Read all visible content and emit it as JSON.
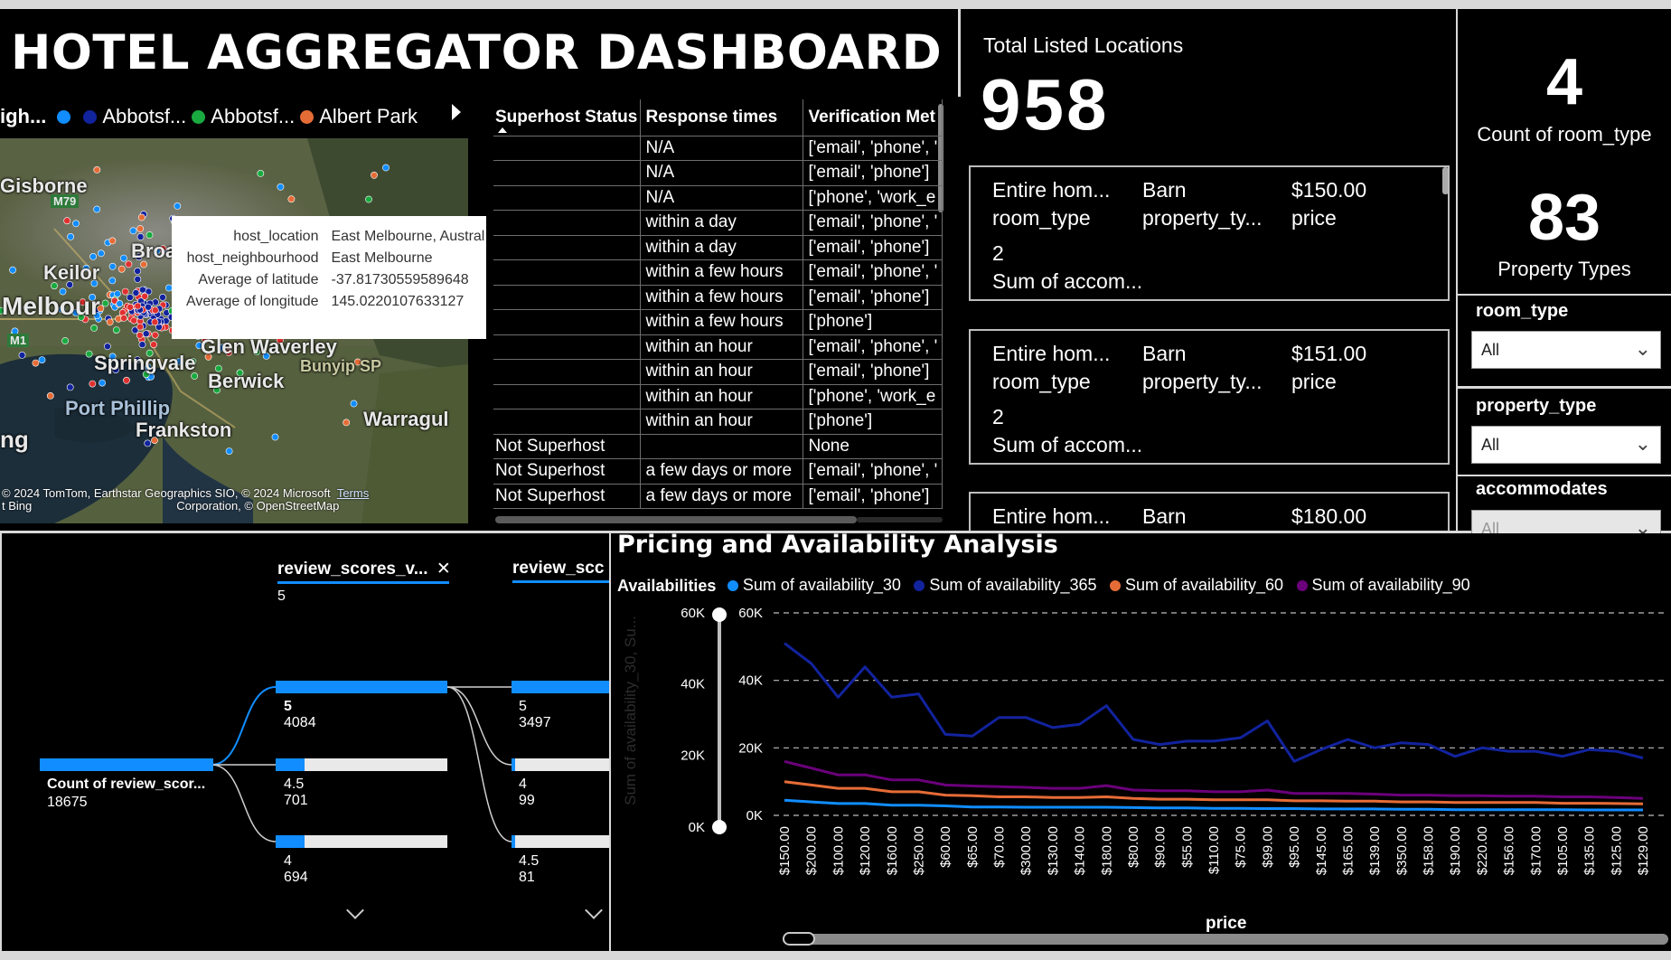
{
  "header": {
    "title": "HOTEL AGGREGATOR DASHBOARD"
  },
  "map": {
    "legend": {
      "truncated_label": "igh...",
      "items": [
        {
          "label": "",
          "color": "#118dff"
        },
        {
          "label": "Abbotsf...",
          "color": "#12239e"
        },
        {
          "label": "Abbotsf...",
          "color": "#1aab40"
        },
        {
          "label": "Albert Park",
          "color": "#e66c37"
        }
      ]
    },
    "place_labels": [
      "Gisborne",
      "Keilor",
      "Broa",
      "Melbour",
      "Glen Waverley",
      "Springvale",
      "Bunyip SP",
      "Berwick",
      "Port Phillip",
      "Warragul",
      "Frankston",
      "ng",
      "M79",
      "M1"
    ],
    "tooltip": {
      "rows": [
        {
          "key": "host_location",
          "value": "East Melbourne, Austral"
        },
        {
          "key": "host_neighbourhood",
          "value": "East Melbourne"
        },
        {
          "key": "Average of latitude",
          "value": "-37.81730559589648"
        },
        {
          "key": "Average of longitude",
          "value": "145.0220107633127"
        }
      ]
    },
    "attribution": "© 2024 TomTom, Earthstar Geographics SIO, © 2024 Microsoft",
    "attribution2": "Corporation, © OpenStreetMap",
    "attribution_terms": "Terms",
    "attribution_bing": "t Bing"
  },
  "host_table": {
    "columns": [
      "Superhost Status",
      "Response times",
      "Verification Met"
    ],
    "rows": [
      [
        "",
        "N/A",
        "['email', 'phone', '"
      ],
      [
        "",
        "N/A",
        "['email', 'phone']"
      ],
      [
        "",
        "N/A",
        "['phone', 'work_e"
      ],
      [
        "",
        "within a day",
        "['email', 'phone', '"
      ],
      [
        "",
        "within a day",
        "['email', 'phone']"
      ],
      [
        "",
        "within a few hours",
        "['email', 'phone', '"
      ],
      [
        "",
        "within a few hours",
        "['email', 'phone']"
      ],
      [
        "",
        "within a few hours",
        "['phone']"
      ],
      [
        "",
        "within an hour",
        "['email', 'phone', '"
      ],
      [
        "",
        "within an hour",
        "['email', 'phone']"
      ],
      [
        "",
        "within an hour",
        "['phone', 'work_e"
      ],
      [
        "",
        "within an hour",
        "['phone']"
      ],
      [
        "Not Superhost",
        "",
        "None"
      ],
      [
        "Not Superhost",
        "a few days or more",
        "['email', 'phone', '"
      ],
      [
        "Not Superhost",
        "a few days or more",
        "['email', 'phone']"
      ]
    ]
  },
  "kpis": {
    "total_locations_label": "Total Listed Locations",
    "total_locations_value": "958",
    "room_type_count": "4",
    "room_type_count_label": "Count of room_type",
    "property_types_count": "83",
    "property_types_label": "Property Types"
  },
  "cards": [
    {
      "room_type": "Entire hom...",
      "room_type_label": "room_type",
      "property_type": "Barn",
      "property_type_label": "property_ty...",
      "price": "$150.00",
      "price_label": "price",
      "accommodates": "2",
      "accommodates_label": "Sum of accom..."
    },
    {
      "room_type": "Entire hom...",
      "room_type_label": "room_type",
      "property_type": "Barn",
      "property_type_label": "property_ty...",
      "price": "$151.00",
      "price_label": "price",
      "accommodates": "2",
      "accommodates_label": "Sum of accom..."
    },
    {
      "room_type": "Entire hom...",
      "property_type": "Barn",
      "price": "$180.00"
    }
  ],
  "slicers": [
    {
      "label": "room_type",
      "value": "All"
    },
    {
      "label": "property_type",
      "value": "All"
    },
    {
      "label": "accommodates",
      "value": "All"
    }
  ],
  "decomposition": {
    "level1_header": "review_scores_v...",
    "level1_selected": "5",
    "level2_header": "review_scc",
    "root": {
      "label": "Count of review_scor...",
      "value": "18675"
    },
    "level1": [
      {
        "label": "5",
        "value": "4084",
        "fraction": 1.0
      },
      {
        "label": "4.5",
        "value": "701",
        "fraction": 0.17
      },
      {
        "label": "4",
        "value": "694",
        "fraction": 0.17
      }
    ],
    "level2": [
      {
        "label": "5",
        "value": "3497",
        "fraction": 1.0
      },
      {
        "label": "4",
        "value": "99",
        "fraction": 0.03
      },
      {
        "label": "4.5",
        "value": "81",
        "fraction": 0.02
      }
    ]
  },
  "chart_data": {
    "type": "line",
    "title": "Pricing and Availability Analysis",
    "legend_title": "Availabilities",
    "xlabel": "price",
    "ylabel": "Sum of availability_30, Su...",
    "ylim": [
      0,
      60000
    ],
    "y_ticks": [
      "60K",
      "40K",
      "20K",
      "0K"
    ],
    "slider_ticks": [
      "60K",
      "40K",
      "20K",
      "0K"
    ],
    "grid": true,
    "legend_position": "top",
    "categories": [
      "$150.00",
      "$200.00",
      "$100.00",
      "$120.00",
      "$160.00",
      "$250.00",
      "$60.00",
      "$65.00",
      "$70.00",
      "$300.00",
      "$130.00",
      "$140.00",
      "$180.00",
      "$80.00",
      "$90.00",
      "$55.00",
      "$110.00",
      "$75.00",
      "$99.00",
      "$95.00",
      "$145.00",
      "$165.00",
      "$139.00",
      "$350.00",
      "$158.00",
      "$190.00",
      "$220.00",
      "$156.00",
      "$170.00",
      "$105.00",
      "$135.00",
      "$125.00",
      "$129.00"
    ],
    "series": [
      {
        "name": "Sum of availability_30",
        "color": "#118dff",
        "values": [
          4500,
          4000,
          3500,
          3500,
          3000,
          3000,
          2800,
          2500,
          2500,
          2400,
          2400,
          2400,
          2400,
          2300,
          2200,
          2200,
          2100,
          2100,
          2000,
          2000,
          1900,
          1900,
          1900,
          1800,
          1800,
          1700,
          1700,
          1700,
          1700,
          1700,
          1600,
          1600,
          1600
        ]
      },
      {
        "name": "Sum of availability_365",
        "color": "#12239e",
        "values": [
          51000,
          45000,
          35000,
          44000,
          35000,
          36000,
          24000,
          23500,
          29000,
          29000,
          26000,
          27000,
          32500,
          22500,
          21000,
          22000,
          22000,
          23000,
          28000,
          16000,
          19500,
          22500,
          20000,
          21500,
          21000,
          17500,
          20000,
          19000,
          19000,
          17500,
          19500,
          19000,
          17000
        ]
      },
      {
        "name": "Sum of availability_60",
        "color": "#e66c37",
        "values": [
          10000,
          9000,
          8000,
          8000,
          7000,
          7000,
          6000,
          5800,
          5500,
          5500,
          5300,
          5300,
          5500,
          5000,
          4800,
          4800,
          4600,
          4600,
          4600,
          4300,
          4300,
          4200,
          4200,
          4000,
          4000,
          3800,
          3800,
          3800,
          3800,
          3600,
          3600,
          3500,
          3400
        ]
      },
      {
        "name": "Sum of availability_90",
        "color": "#6b007b",
        "values": [
          16000,
          14000,
          12000,
          12000,
          10500,
          10500,
          9000,
          8700,
          8500,
          8300,
          8000,
          8000,
          8800,
          7500,
          7300,
          7300,
          7000,
          7000,
          7500,
          6500,
          6500,
          6500,
          6300,
          6000,
          6000,
          5800,
          5800,
          5700,
          5700,
          5500,
          5500,
          5300,
          5000
        ]
      }
    ]
  }
}
